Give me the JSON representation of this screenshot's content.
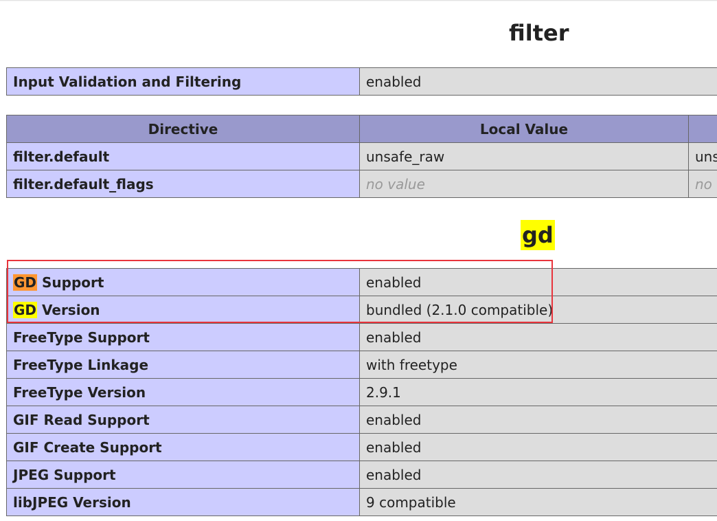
{
  "filter_section": {
    "title": "filter",
    "summary_row": {
      "label": "Input Validation and Filtering",
      "value": "enabled"
    },
    "directives_headers": [
      "Directive",
      "Local Value",
      ""
    ],
    "directives": [
      {
        "name": "filter.default",
        "local": "unsafe_raw",
        "master": "uns"
      },
      {
        "name": "filter.default_flags",
        "local": "no value",
        "master": "no"
      }
    ]
  },
  "gd_section": {
    "title": "gd",
    "highlight_term": "GD",
    "rows": [
      {
        "prefix": "GD",
        "label": " Support",
        "value": "enabled"
      },
      {
        "prefix": "GD",
        "label": " Version",
        "value": "bundled (2.1.0 compatible)"
      },
      {
        "label": "FreeType Support",
        "value": "enabled"
      },
      {
        "label": "FreeType Linkage",
        "value": "with freetype"
      },
      {
        "label": "FreeType Version",
        "value": "2.9.1"
      },
      {
        "label": "GIF Read Support",
        "value": "enabled"
      },
      {
        "label": "GIF Create Support",
        "value": "enabled"
      },
      {
        "label": "JPEG Support",
        "value": "enabled"
      },
      {
        "label": "libJPEG Version",
        "value": "9 compatible"
      }
    ]
  },
  "colors": {
    "header_bg": "#9999cc",
    "label_bg": "#ccccff",
    "value_bg": "#dddddd",
    "highlight_current": "#ff9632",
    "highlight_match": "#ffff00",
    "annotation_box": "#e8343c"
  }
}
